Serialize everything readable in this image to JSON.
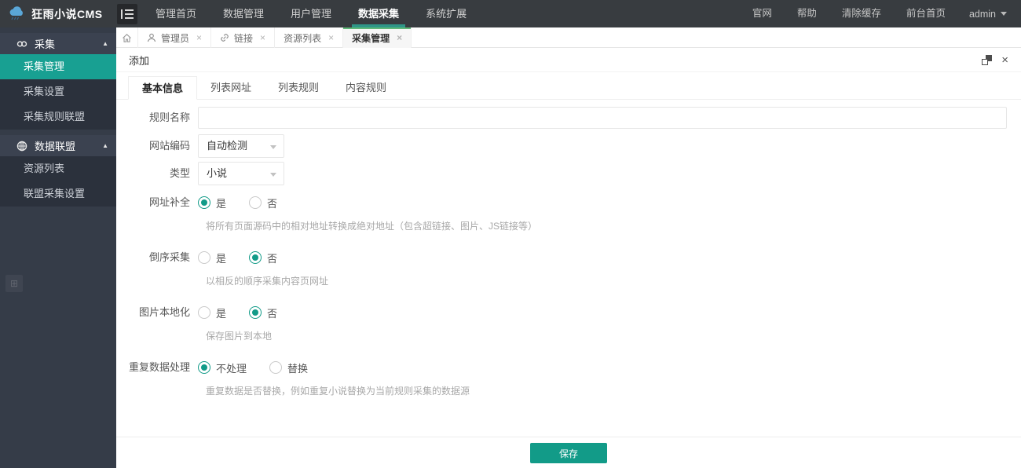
{
  "topbar": {
    "logo_text": "狂雨小说CMS",
    "menu": [
      {
        "label": "管理首页"
      },
      {
        "label": "数据管理"
      },
      {
        "label": "用户管理"
      },
      {
        "label": "数据采集",
        "active": true
      },
      {
        "label": "系统扩展"
      }
    ],
    "right": [
      {
        "label": "官网"
      },
      {
        "label": "帮助"
      },
      {
        "label": "清除缓存"
      },
      {
        "label": "前台首页"
      }
    ],
    "user_label": "admin"
  },
  "sidebar": {
    "sections": [
      {
        "label": "采集",
        "icon": "link-icon",
        "items": [
          {
            "label": "采集管理",
            "active": true
          },
          {
            "label": "采集设置"
          },
          {
            "label": "采集规则联盟"
          }
        ]
      },
      {
        "label": "数据联盟",
        "icon": "globe-icon",
        "items": [
          {
            "label": "资源列表"
          },
          {
            "label": "联盟采集设置"
          }
        ]
      }
    ]
  },
  "tabbar": {
    "tabs": [
      {
        "label": "管理员",
        "icon": "person-icon"
      },
      {
        "label": "链接",
        "icon": "link-icon"
      },
      {
        "label": "资源列表"
      },
      {
        "label": "采集管理",
        "active": true
      }
    ]
  },
  "panel": {
    "title": "添加",
    "tabs": [
      {
        "label": "基本信息",
        "active": true
      },
      {
        "label": "列表网址"
      },
      {
        "label": "列表规则"
      },
      {
        "label": "内容规则"
      }
    ]
  },
  "form": {
    "fields": [
      {
        "label": "规则名称",
        "type": "input",
        "value": ""
      },
      {
        "label": "网站编码",
        "type": "select",
        "value": "自动检测"
      },
      {
        "label": "类型",
        "type": "select",
        "value": "小说"
      },
      {
        "label": "网址补全",
        "type": "radio",
        "options": [
          "是",
          "否"
        ],
        "selected": "是",
        "help": "将所有页面源码中的相对地址转换成绝对地址（包含超链接、图片、JS链接等）"
      },
      {
        "label": "倒序采集",
        "type": "radio",
        "options": [
          "是",
          "否"
        ],
        "selected": "否",
        "help": "以相反的顺序采集内容页网址"
      },
      {
        "label": "图片本地化",
        "type": "radio",
        "options": [
          "是",
          "否"
        ],
        "selected": "否",
        "help": "保存图片到本地"
      },
      {
        "label": "重复数据处理",
        "type": "radio",
        "options": [
          "不处理",
          "替换"
        ],
        "selected": "不处理",
        "help": "重复数据是否替换，例如重复小说替换为当前规则采集的数据源"
      }
    ]
  },
  "footer": {
    "save_label": "保存"
  },
  "icons": {
    "close": "×",
    "caret_up": "▲",
    "handle": "⊞"
  },
  "colors": {
    "topbar_bg": "#383c40",
    "sidebar_bg": "#353c48",
    "sidebar_item_bg": "#2b313c",
    "active_teal": "#18a092",
    "save_green": "#129b88",
    "menu_underline": "#2f9688",
    "tab_active_border": "#5fb878"
  }
}
